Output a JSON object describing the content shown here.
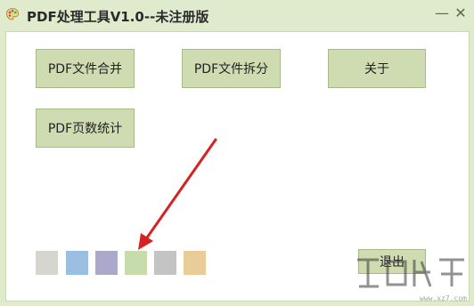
{
  "window": {
    "title": "PDF处理工具V1.0--未注册版",
    "minimize": "—",
    "close": "✕"
  },
  "buttons": {
    "merge": "PDF文件合并",
    "split": "PDF文件拆分",
    "about": "关于",
    "page_count": "PDF页数统计",
    "exit": "退出"
  },
  "theme_swatches": [
    "#d6d5d0",
    "#9bbfe3",
    "#aca8cc",
    "#c6dcab",
    "#c4c4c4",
    "#e9cc97"
  ],
  "colors": {
    "accent": "#cfdcb2",
    "arrow": "#d62222"
  },
  "watermark_url": "www.xz7.com"
}
